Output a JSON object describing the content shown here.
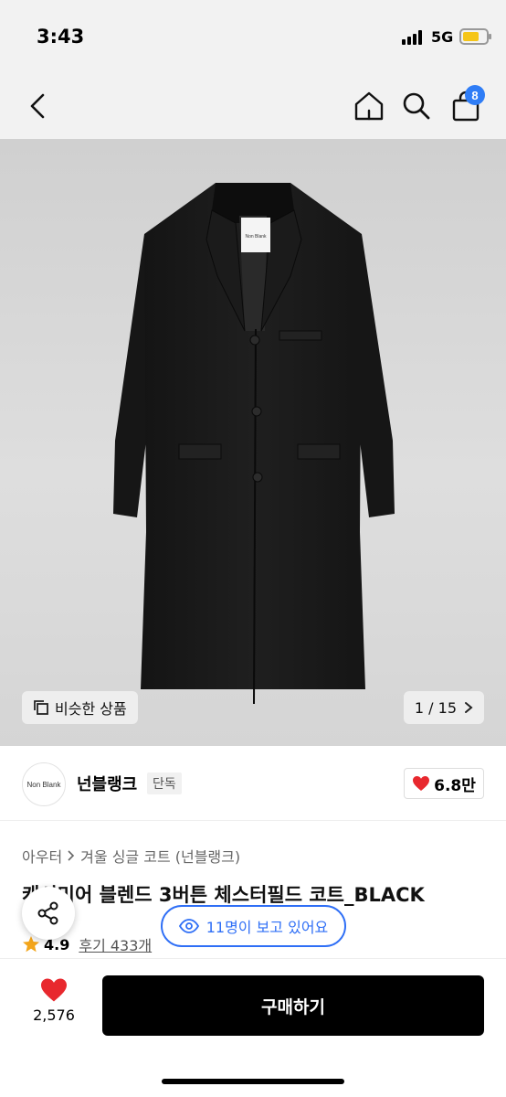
{
  "status_bar": {
    "time": "3:43",
    "network": "5G",
    "battery_level": 0.7
  },
  "header": {
    "back_icon": "chevron-left-icon",
    "home_icon": "home-icon",
    "search_icon": "search-icon",
    "cart_icon": "shopping-bag-icon",
    "cart_count": "8"
  },
  "product_image": {
    "tag_text": "Non Blank",
    "similar_label": "비슷한 상품",
    "pager": "1 / 15"
  },
  "brand": {
    "logo_text": "Non Blank",
    "name": "넌블랭크",
    "exclusive_label": "단독",
    "likes": "6.8만"
  },
  "breadcrumb": {
    "category": "아우터",
    "subcategory": "겨울 싱글 코트 (넌블랭크)"
  },
  "product": {
    "title": "캐시미어 블렌드 3버튼 체스터필드 코트_BLACK",
    "rating": "4.9",
    "reviews_label": "후기 433개"
  },
  "overlay": {
    "viewing_label": "11명이 보고 있어요"
  },
  "bottom_bar": {
    "like_count": "2,576",
    "buy_label": "구매하기"
  },
  "colors": {
    "accent": "#2f6ff6",
    "heart": "#e8282e",
    "buy_button": "#000000"
  }
}
